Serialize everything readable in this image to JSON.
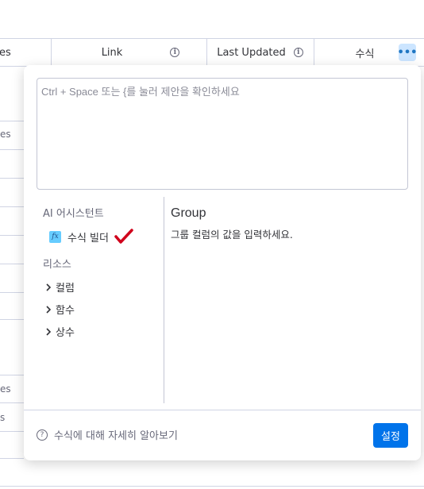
{
  "board": {
    "columns": [
      {
        "label": "es",
        "info": false
      },
      {
        "label": "Link",
        "info": true
      },
      {
        "label": "Last Updated",
        "info": true
      },
      {
        "label": "수식",
        "info": false
      }
    ],
    "row_fragments": [
      "es",
      "es",
      "es",
      "s"
    ],
    "more_label": "•••"
  },
  "formula_popup": {
    "editor_placeholder": "Ctrl + Space 또는 {를 눌러 제안을 확인하세요",
    "sidebar": {
      "ai_title": "AI 어시스턴트",
      "formula_builder_label": "수식 빌더",
      "formula_builder_icon": "fx-icon",
      "resources_title": "리소스",
      "tree": [
        "컬럼",
        "함수",
        "상수"
      ]
    },
    "detail": {
      "title": "Group",
      "description": "그룹 컬럼의 값을 입력하세요."
    },
    "footer": {
      "help_label": "수식에 대해 자세히 알아보기",
      "settings_label": "설정"
    }
  },
  "colors": {
    "accent": "#0073ea",
    "more_bg": "#cce5ff",
    "check": "#d0021b"
  }
}
